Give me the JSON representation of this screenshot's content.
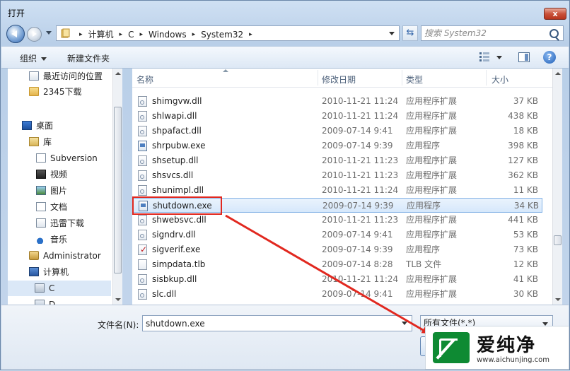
{
  "window": {
    "title": "打开",
    "close_label": "x"
  },
  "address": {
    "crumbs": [
      "计算机",
      "C",
      "Windows",
      "System32"
    ]
  },
  "search": {
    "placeholder": "搜索 System32"
  },
  "toolbar": {
    "organize_label": "组织",
    "new_folder_label": "新建文件夹",
    "help_label": "?"
  },
  "nav": {
    "items": [
      {
        "label": "最近访问的位置",
        "icon": "recent-places-icon"
      },
      {
        "label": "2345下载",
        "icon": "folder-icon"
      },
      {
        "label": "桌面",
        "icon": "desktop-icon"
      },
      {
        "label": "库",
        "icon": "libraries-icon"
      },
      {
        "label": "Subversion",
        "icon": "document-library-icon"
      },
      {
        "label": "视频",
        "icon": "video-library-icon"
      },
      {
        "label": "图片",
        "icon": "pictures-library-icon"
      },
      {
        "label": "文档",
        "icon": "documents-library-icon"
      },
      {
        "label": "迅雷下载",
        "icon": "downloads-library-icon"
      },
      {
        "label": "音乐",
        "icon": "music-library-icon"
      },
      {
        "label": "Administrator",
        "icon": "user-folder-icon"
      },
      {
        "label": "计算机",
        "icon": "computer-icon"
      },
      {
        "label": "C",
        "icon": "drive-c-icon"
      },
      {
        "label": "D",
        "icon": "drive-d-icon"
      }
    ],
    "selected": "C"
  },
  "columns": {
    "name": "名称",
    "date": "修改日期",
    "type": "类型",
    "size": "大小"
  },
  "files": [
    {
      "name": "shimgvw.dll",
      "date": "2010-11-21 11:24",
      "type": "应用程序扩展",
      "size": "37 KB",
      "kind": "dll"
    },
    {
      "name": "shlwapi.dll",
      "date": "2010-11-21 11:24",
      "type": "应用程序扩展",
      "size": "438 KB",
      "kind": "dll"
    },
    {
      "name": "shpafact.dll",
      "date": "2009-07-14 9:41",
      "type": "应用程序扩展",
      "size": "18 KB",
      "kind": "dll"
    },
    {
      "name": "shrpubw.exe",
      "date": "2009-07-14 9:39",
      "type": "应用程序",
      "size": "398 KB",
      "kind": "exe"
    },
    {
      "name": "shsetup.dll",
      "date": "2010-11-21 11:23",
      "type": "应用程序扩展",
      "size": "127 KB",
      "kind": "dll"
    },
    {
      "name": "shsvcs.dll",
      "date": "2010-11-21 11:23",
      "type": "应用程序扩展",
      "size": "362 KB",
      "kind": "dll"
    },
    {
      "name": "shunimpl.dll",
      "date": "2010-11-21 11:24",
      "type": "应用程序扩展",
      "size": "11 KB",
      "kind": "dll"
    },
    {
      "name": "shutdown.exe",
      "date": "2009-07-14 9:39",
      "type": "应用程序",
      "size": "34 KB",
      "kind": "exe",
      "selected": true
    },
    {
      "name": "shwebsvc.dll",
      "date": "2010-11-21 11:23",
      "type": "应用程序扩展",
      "size": "441 KB",
      "kind": "dll"
    },
    {
      "name": "signdrv.dll",
      "date": "2009-07-14 9:41",
      "type": "应用程序扩展",
      "size": "53 KB",
      "kind": "dll"
    },
    {
      "name": "sigverif.exe",
      "date": "2009-07-14 9:39",
      "type": "应用程序",
      "size": "73 KB",
      "kind": "chk"
    },
    {
      "name": "simpdata.tlb",
      "date": "2009-07-14 8:28",
      "type": "TLB 文件",
      "size": "12 KB",
      "kind": "tlb"
    },
    {
      "name": "sisbkup.dll",
      "date": "2010-11-21 11:24",
      "type": "应用程序扩展",
      "size": "41 KB",
      "kind": "dll"
    },
    {
      "name": "slc.dll",
      "date": "2009-07-14 9:41",
      "type": "应用程序扩展",
      "size": "30 KB",
      "kind": "dll"
    }
  ],
  "bottom": {
    "filename_label": "文件名(N):",
    "filename_value": "shutdown.exe",
    "filter_label": "所有文件(*.*)"
  },
  "watermark": {
    "brand": "爱纯净",
    "url": "www.aichunjing.com"
  },
  "colors": {
    "highlight": "#e1281f",
    "selection": "#d6e8fb"
  }
}
